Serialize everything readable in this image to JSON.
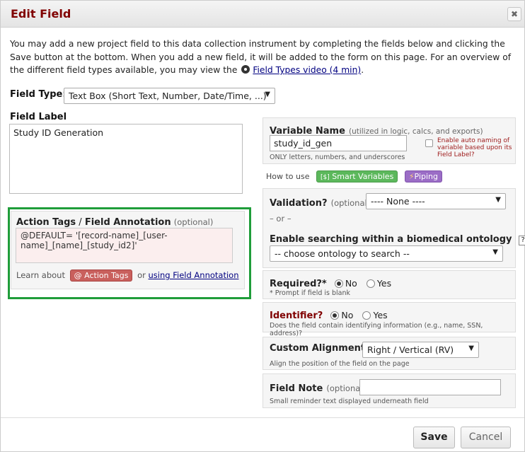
{
  "dialog": {
    "title": "Edit Field",
    "close_label": "✖"
  },
  "intro": {
    "text": "You may add a new project field to this data collection instrument by completing the fields below and clicking the Save button at the bottom. When you add a new field, it will be added to the form on this page. For an overview of the different field types available, you may view the",
    "video_link": "Field Types video (4 min)",
    "end": "."
  },
  "field_type": {
    "label": "Field Type:",
    "value": "Text Box (Short Text, Number, Date/Time, ...)"
  },
  "field_label": {
    "label": "Field Label",
    "value": "Study ID Generation"
  },
  "action_tags": {
    "label_a": "Action Tags",
    "label_sep": " / ",
    "label_b": "Field Annotation",
    "optional": "(optional)",
    "value": "@DEFAULT= '[record-name]_[user-name]_[name]_[study_id2]'",
    "learn_about": "Learn about",
    "badge": "@ Action Tags",
    "or": "or",
    "link": "using Field Annotation"
  },
  "variable_name": {
    "label": "Variable Name",
    "hint": "(utilized in logic, calcs, and exports)",
    "value": "study_id_gen",
    "note": "ONLY letters, numbers, and underscores",
    "auto_label": "Enable auto naming of variable based upon its Field Label?"
  },
  "how_to_use": {
    "label": "How to use",
    "smart_variables": "Smart Variables",
    "piping": "Piping"
  },
  "validation": {
    "label": "Validation?",
    "optional": "(optional)",
    "value": "---- None ----",
    "or": "– or –",
    "ontology_label": "Enable searching within a biomedical ontology",
    "help": "?",
    "ontology_value": "-- choose ontology to search --"
  },
  "required": {
    "label": "Required?*",
    "no": "No",
    "yes": "Yes",
    "note": "* Prompt if field is blank",
    "selected": "No"
  },
  "identifier": {
    "label": "Identifier?",
    "no": "No",
    "yes": "Yes",
    "note": "Does the field contain identifying information (e.g., name, SSN, address)?",
    "selected": "No"
  },
  "alignment": {
    "label": "Custom Alignment",
    "value": "Right / Vertical (RV)",
    "note": "Align the position of the field on the page"
  },
  "field_note": {
    "label": "Field Note",
    "optional": "(optional)",
    "value": "",
    "note": "Small reminder text displayed underneath field"
  },
  "footer": {
    "save": "Save",
    "cancel": "Cancel"
  },
  "colors": {
    "title": "#800000",
    "highlight_border": "#1f9d3a",
    "smart_variables_badge": "#5cb85c",
    "piping_badge": "#9b6dc6",
    "action_tags_badge": "#c9605d",
    "annotation_bg": "#fbeeee"
  }
}
